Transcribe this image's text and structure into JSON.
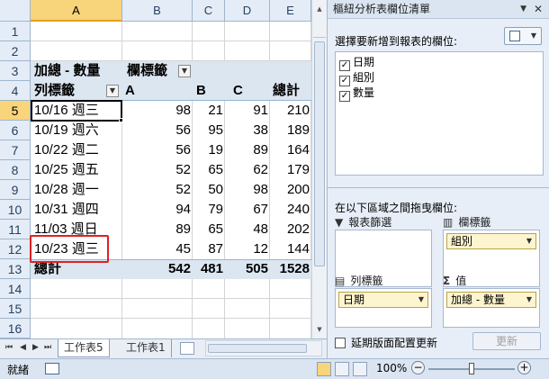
{
  "spreadsheet": {
    "columns": [
      "A",
      "B",
      "C",
      "D",
      "E"
    ],
    "rows": [
      "1",
      "2",
      "3",
      "4",
      "5",
      "6",
      "7",
      "8",
      "9",
      "10",
      "11",
      "12",
      "13",
      "14",
      "15",
      "16"
    ],
    "pivot_title": "加總 - 數量",
    "col_labels_header": "欄標籤",
    "row_labels_header": "列標籤",
    "group_headers": [
      "A",
      "B",
      "C"
    ],
    "total_header": "總計",
    "data_rows": [
      {
        "label": "10/16 週三",
        "a": "98",
        "b": "21",
        "c": "91",
        "t": "210"
      },
      {
        "label": "10/19 週六",
        "a": "56",
        "b": "95",
        "c": "38",
        "t": "189"
      },
      {
        "label": "10/22 週二",
        "a": "56",
        "b": "19",
        "c": "89",
        "t": "164"
      },
      {
        "label": "10/25 週五",
        "a": "52",
        "b": "65",
        "c": "62",
        "t": "179"
      },
      {
        "label": "10/28 週一",
        "a": "52",
        "b": "50",
        "c": "98",
        "t": "200"
      },
      {
        "label": "10/31 週四",
        "a": "94",
        "b": "79",
        "c": "67",
        "t": "240"
      },
      {
        "label": "11/03 週日",
        "a": "89",
        "b": "65",
        "c": "48",
        "t": "202"
      },
      {
        "label": "10/23 週三",
        "a": "45",
        "b": "87",
        "c": "12",
        "t": "144"
      }
    ],
    "grand_total": {
      "label": "總計",
      "a": "542",
      "b": "481",
      "c": "505",
      "t": "1528"
    }
  },
  "sheet_tabs": [
    "工作表5",
    "工作表1"
  ],
  "status_bar": {
    "ready": "就緒",
    "zoom": "100%"
  },
  "panel": {
    "title": "樞紐分析表欄位清單",
    "choose_fields": "選擇要新增到報表的欄位:",
    "fields": [
      {
        "label": "日期",
        "checked": true
      },
      {
        "label": "組別",
        "checked": true
      },
      {
        "label": "數量",
        "checked": true
      }
    ],
    "drag_label": "在以下區域之間拖曳欄位:",
    "filter_zone": "報表篩選",
    "column_zone": "欄標籤",
    "row_zone": "列標籤",
    "values_zone": "值",
    "column_chip": "組別",
    "row_chip": "日期",
    "values_chip": "加總 - 數量",
    "defer_update": "延期版面配置更新",
    "update_button": "更新"
  },
  "colors": {
    "selected_header": "#f8d47a",
    "pivot_header_fill": "#dce6f1",
    "highlight_box": "#e02020"
  }
}
